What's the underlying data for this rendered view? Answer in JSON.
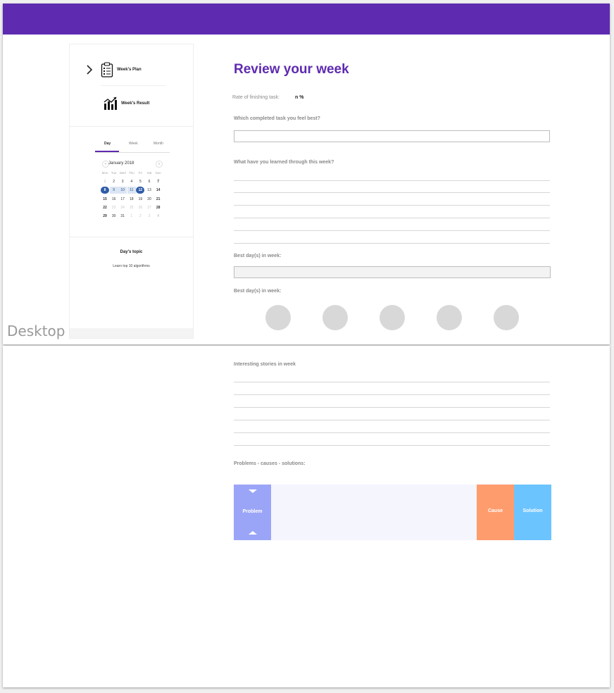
{
  "artboard_label": "Desktop",
  "colors": {
    "brand": "#5e2ab0",
    "calendar_selected": "#2f5ca8",
    "calendar_range": "#dbe6f4",
    "problem": "#9ba5f7",
    "cause": "#ff9c6e",
    "solution": "#6cc4ff"
  },
  "sidebar": {
    "nav": {
      "expand_icon": "chevron-right-icon",
      "plan": {
        "label": "Week's Plan",
        "icon": "clipboard-checklist-icon"
      },
      "result": {
        "label": "Week's Result",
        "icon": "bar-chart-trend-icon"
      }
    },
    "calendar": {
      "tabs": [
        "Day",
        "Week",
        "Month"
      ],
      "active_tab": "Day",
      "month_label": "January 2018",
      "prev_label": "‹",
      "next_label": "›",
      "weekdays": [
        "Mon",
        "Tue",
        "Wed",
        "Thu",
        "Fri",
        "Sat",
        "Sun"
      ],
      "weeks": [
        [
          "1",
          "2",
          "3",
          "4",
          "5",
          "6",
          "7"
        ],
        [
          "8",
          "9",
          "10",
          "11",
          "12",
          "13",
          "14"
        ],
        [
          "15",
          "16",
          "17",
          "18",
          "19",
          "20",
          "21"
        ],
        [
          "22",
          "23",
          "24",
          "25",
          "26",
          "27",
          "28"
        ],
        [
          "29",
          "30",
          "31",
          "1",
          "2",
          "3",
          "4"
        ]
      ],
      "selected_start": "8",
      "selected_end": "12"
    },
    "topic": {
      "title": "Day's topic",
      "text": "Learn top 10 algorithms"
    }
  },
  "main": {
    "title": "Review your week",
    "rate_label": "Rate of finishing task:",
    "rate_value": "n %",
    "best_task_label": "Which completed task you feel best?",
    "best_task_value": "",
    "learned_label": "What have you learned through this week?",
    "best_days_label": "Best day(s) in week:",
    "best_days_value": "",
    "best_days_label_2": "Best day(s) in week:",
    "stories_label": "Interesting stories in week",
    "pcs_label": "Problems - causes - solutions:",
    "pcs": {
      "problem": "Problem",
      "cause": "Cause",
      "solution": "Solution"
    }
  }
}
